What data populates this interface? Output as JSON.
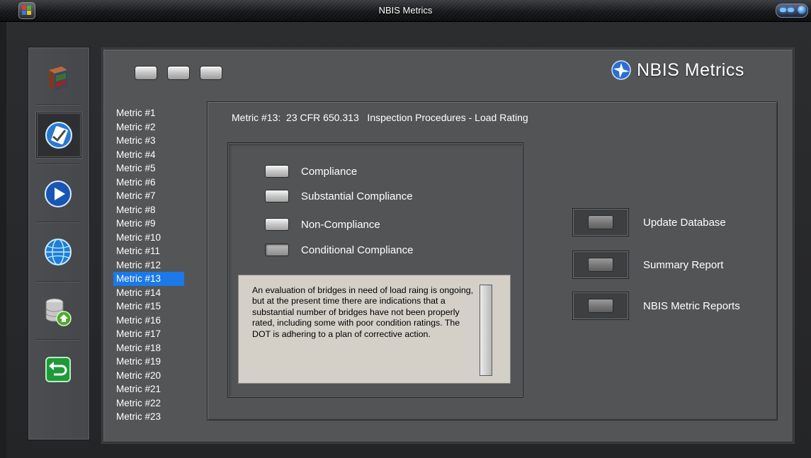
{
  "window": {
    "title": "NBIS Metrics"
  },
  "logo": {
    "text": "NBIS Metrics",
    "icon": "nbis-logo-icon"
  },
  "toolbar": {
    "buttons": [
      "blank",
      "blank",
      "blank"
    ]
  },
  "sidebar": {
    "items": [
      {
        "name": "book-icon",
        "active": false
      },
      {
        "name": "checklist-icon",
        "active": true
      },
      {
        "name": "play-icon",
        "active": false
      },
      {
        "name": "globe-icon",
        "active": false
      },
      {
        "name": "database-home-icon",
        "active": false
      },
      {
        "name": "return-icon",
        "active": false
      }
    ]
  },
  "metrics": {
    "selected_index": 12,
    "items": [
      "Metric #1",
      "Metric #2",
      "Metric #3",
      "Metric #4",
      "Metric #5",
      "Metric #6",
      "Metric #7",
      "Metric #8",
      "Metric #9",
      "Metric #10",
      "Metric #11",
      "Metric #12",
      "Metric #13",
      "Metric #14",
      "Metric #15",
      "Metric #16",
      "Metric #17",
      "Metric #18",
      "Metric #19",
      "Metric #20",
      "Metric #21",
      "Metric #22",
      "Metric #23"
    ]
  },
  "content": {
    "title": "Metric #13:  23 CFR 650.313   Inspection Procedures - Load Rating",
    "options": [
      {
        "label": "Compliance",
        "checked": false
      },
      {
        "label": "Substantial Compliance",
        "checked": false
      },
      {
        "label": "Non-Compliance",
        "checked": false
      },
      {
        "label": "Conditional Compliance",
        "checked": true
      }
    ],
    "description": "An evaluation of bridges in need of load raing is ongoing, but at the present time there are indications that a substantial number of bridges have not been properly rated, including some with poor condition ratings. The DOT is adhering to a plan of corrective action."
  },
  "actions": {
    "update": "Update Database",
    "summary": "Summary Report",
    "metric_reports": "NBIS Metric Reports"
  },
  "colors": {
    "selection": "#1b79e8",
    "panel": "#535557",
    "description_bg": "#d4d0c8"
  }
}
